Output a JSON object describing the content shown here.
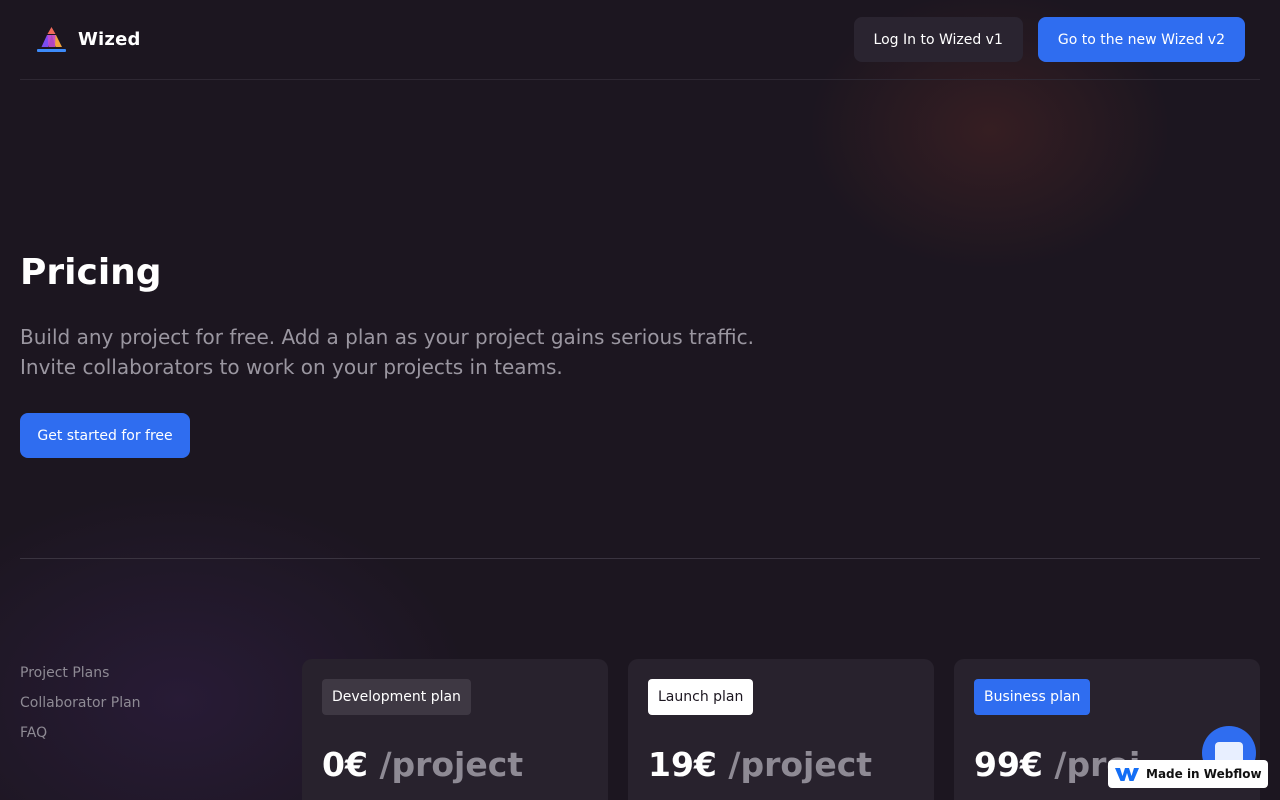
{
  "header": {
    "brand_name": "Wized",
    "login_label": "Log In to Wized v1",
    "v2_label": "Go to the new Wized v2"
  },
  "hero": {
    "title": "Pricing",
    "description": "Build any project for free. Add a plan as your project gains serious traffic. Invite collaborators to work on your projects in teams.",
    "cta_label": "Get started for free"
  },
  "side_nav": {
    "items": [
      {
        "label": "Project Plans"
      },
      {
        "label": "Collaborator Plan"
      },
      {
        "label": "FAQ"
      }
    ]
  },
  "plans": [
    {
      "tag": "Development plan",
      "amount": "0€",
      "unit": "/project"
    },
    {
      "tag": "Launch plan",
      "amount": "19€",
      "unit": "/project"
    },
    {
      "tag": "Business plan",
      "amount": "99€",
      "unit": "/proj"
    }
  ],
  "badge": {
    "label": "Made in Webflow"
  },
  "icons": {
    "logo": "wized-logo-icon",
    "chat": "chat-icon",
    "webflow": "webflow-logo-icon"
  },
  "colors": {
    "background": "#1c1620",
    "accent": "#2f6df0",
    "card": "#28222d",
    "muted_text": "#9a96a0"
  }
}
